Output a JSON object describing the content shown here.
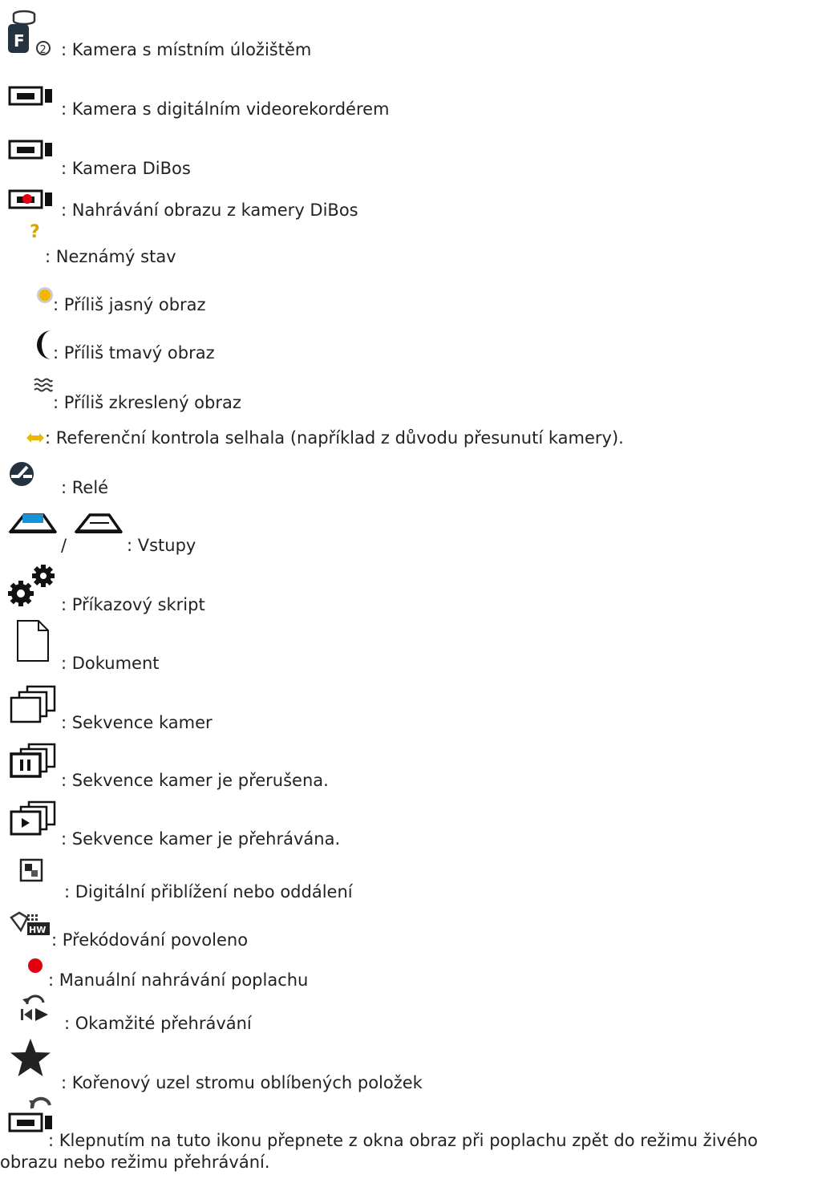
{
  "items": [
    {
      "icon": "local-storage-camera-icon",
      "text": ": Kamera s místním úložištěm"
    },
    {
      "icon": "dvr-camera-icon",
      "text": ": Kamera s digitálním videorekordérem"
    },
    {
      "icon": "dibos-camera-icon",
      "text": ": Kamera DiBos"
    },
    {
      "icon": "dibos-recording-camera-icon",
      "text": ": Nahrávání obrazu z kamery DiBos"
    },
    {
      "icon": "unknown-state-icon",
      "text": ": Neznámý stav"
    },
    {
      "icon": "too-bright-icon",
      "text": ": Příliš jasný obraz"
    },
    {
      "icon": "too-dark-icon",
      "text": ": Příliš tmavý obraz"
    },
    {
      "icon": "too-noisy-icon",
      "text": ": Příliš zkreslený obraz"
    },
    {
      "icon": "reference-check-failed-icon",
      "text": ": Referenční kontrola selhala (například z důvodu přesunutí kamery)."
    },
    {
      "icon": "relay-icon",
      "text": ": Relé"
    },
    {
      "icon": "inputs-icon",
      "separator": "/",
      "text": ": Vstupy"
    },
    {
      "icon": "command-script-icon",
      "text": ": Příkazový skript"
    },
    {
      "icon": "document-icon",
      "text": ": Dokument"
    },
    {
      "icon": "camera-sequence-icon",
      "text": ": Sekvence kamer"
    },
    {
      "icon": "sequence-paused-icon",
      "text": ": Sekvence kamer je přerušena."
    },
    {
      "icon": "sequence-playing-icon",
      "text": ": Sekvence kamer je přehrávána."
    },
    {
      "icon": "digital-zoom-icon",
      "text": ": Digitální přiblížení nebo oddálení"
    },
    {
      "icon": "transcoding-icon",
      "text": ": Překódování povoleno"
    },
    {
      "icon": "manual-alarm-recording-icon",
      "text": ": Manuální nahrávání poplachu"
    },
    {
      "icon": "instant-playback-icon",
      "text": ": Okamžité přehrávání"
    },
    {
      "icon": "favorites-root-icon",
      "text": ": Kořenový uzel stromu oblíbených položek"
    },
    {
      "icon": "back-to-live-icon",
      "text": ": Klepnutím na tuto ikonu přepnete z okna obraz při poplachu zpět do režimu živého",
      "text_line2": "obrazu nebo režimu přehrávání."
    }
  ]
}
